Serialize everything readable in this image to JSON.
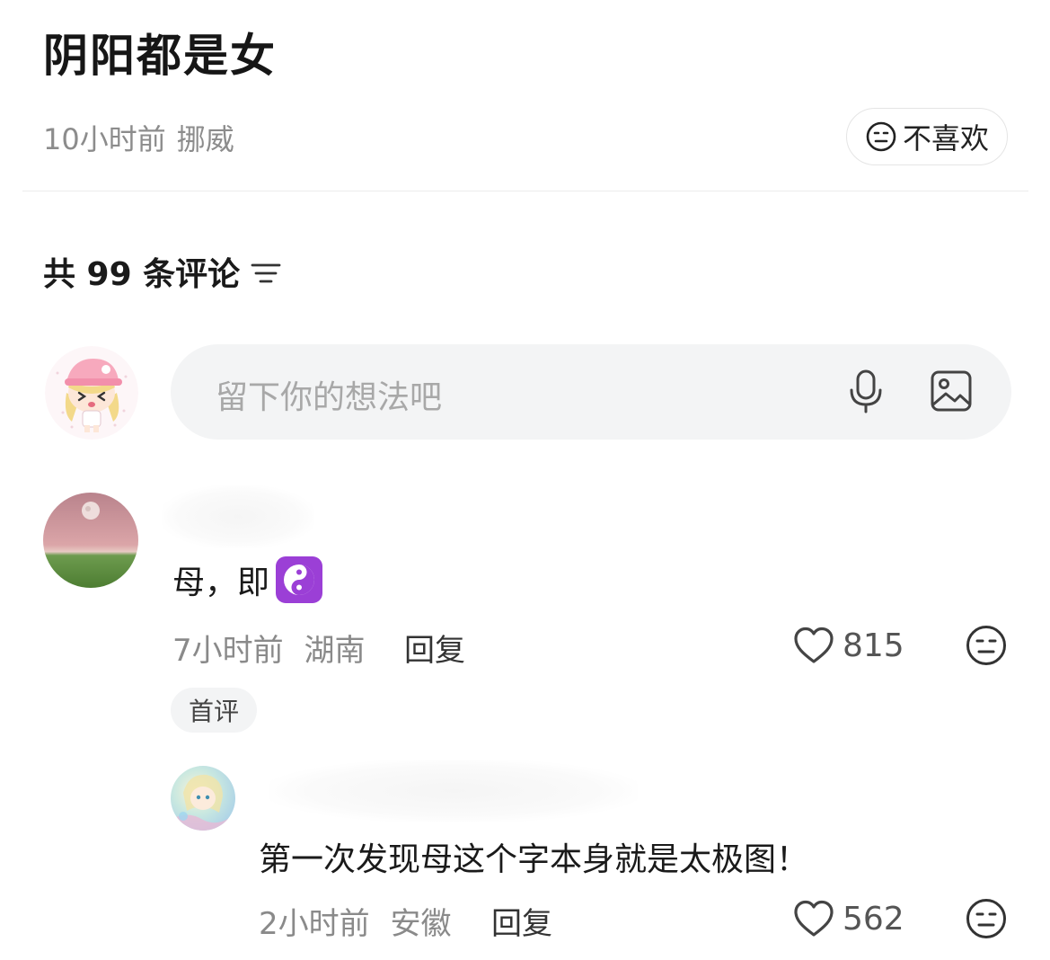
{
  "post": {
    "title": "阴阳都是女",
    "time": "10小时前",
    "location": "挪威",
    "dislike_label": "不喜欢"
  },
  "comments_header": {
    "count_label": "共 99 条评论"
  },
  "input": {
    "placeholder": "留下你的想法吧",
    "icons": [
      "microphone-icon",
      "image-icon"
    ]
  },
  "comments": [
    {
      "text": "母，即",
      "emoji": "yin-yang-emoji",
      "time": "7小时前",
      "location": "湖南",
      "reply_label": "回复",
      "likes": "815",
      "badge": "首评"
    },
    {
      "text": "第一次发现母这个字本身就是太极图！",
      "time": "2小时前",
      "location": "安徽",
      "reply_label": "回复",
      "likes": "562"
    }
  ],
  "colors": {
    "title": "#161616",
    "muted": "#8c8c8c",
    "input_bg": "#f3f4f5",
    "emoji_purple": "#9b3fd6"
  }
}
